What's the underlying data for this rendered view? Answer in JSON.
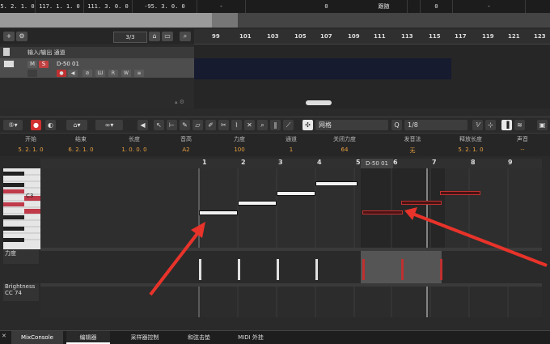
{
  "transport": {
    "cells": [
      "5. 2. 1. 0",
      "117. 1. 1. 0",
      "111. 3. 0. 0",
      "-95. 3. 0. 0",
      "-",
      "0",
      "跟随",
      "0",
      "-"
    ]
  },
  "tracks": {
    "page": "3/3",
    "folder_name": "输入/输出 通道",
    "midi_name": "D-50 01",
    "buttons": [
      "M",
      "S"
    ],
    "rec_buttons": [
      "R",
      "W"
    ]
  },
  "arrange_ruler": [
    "99",
    "101",
    "103",
    "105",
    "107",
    "109",
    "111",
    "113",
    "115",
    "117",
    "119",
    "121",
    "123"
  ],
  "toolbar": {
    "grid_label": "网格",
    "quantize_value": "1/8"
  },
  "infoline": {
    "headers": [
      "开始",
      "结束",
      "长度",
      "音高",
      "力度",
      "通道",
      "关闭力度",
      "发音法",
      "释放长度",
      "声音"
    ],
    "values": [
      "5. 2. 1. 0",
      "6. 2. 1. 0",
      "1. 0. 0. 0",
      "A2",
      "100",
      "1",
      "64",
      "无",
      "5. 2. 1. 0",
      "--"
    ]
  },
  "editor": {
    "ruler": [
      "1",
      "2",
      "3",
      "4",
      "5",
      "6",
      "7",
      "8",
      "9"
    ],
    "part_label": "D-50 01",
    "key_label": "C3",
    "velocity_label": "力度",
    "cc_label": "Brightness",
    "cc_number": "CC 74"
  },
  "tabs": [
    "MixConsole",
    "编辑器",
    "采样器控制",
    "和弦击垫",
    "MIDI 外挂"
  ],
  "colors": {
    "accent": "#e8a040",
    "record": "#d03030",
    "arrow": "#e8332a"
  }
}
